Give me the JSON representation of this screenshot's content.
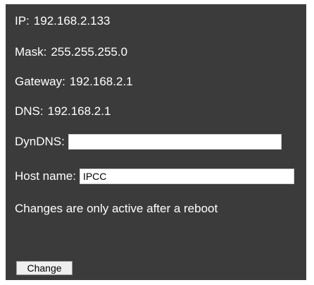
{
  "network": {
    "ip_label": "IP:",
    "ip_value": "192.168.2.133",
    "mask_label": "Mask:",
    "mask_value": "255.255.255.0",
    "gateway_label": "Gateway:",
    "gateway_value": "192.168.2.1",
    "dns_label": "DNS:",
    "dns_value": "192.168.2.1"
  },
  "form": {
    "dyndns_label": "DynDNS:",
    "dyndns_value": "",
    "hostname_label": "Host name:",
    "hostname_value": "IPCC",
    "notice": "Changes are only active after a reboot",
    "change_button": "Change"
  },
  "colors": {
    "panel_background": "#3b3b3b",
    "text": "#ffffff"
  }
}
